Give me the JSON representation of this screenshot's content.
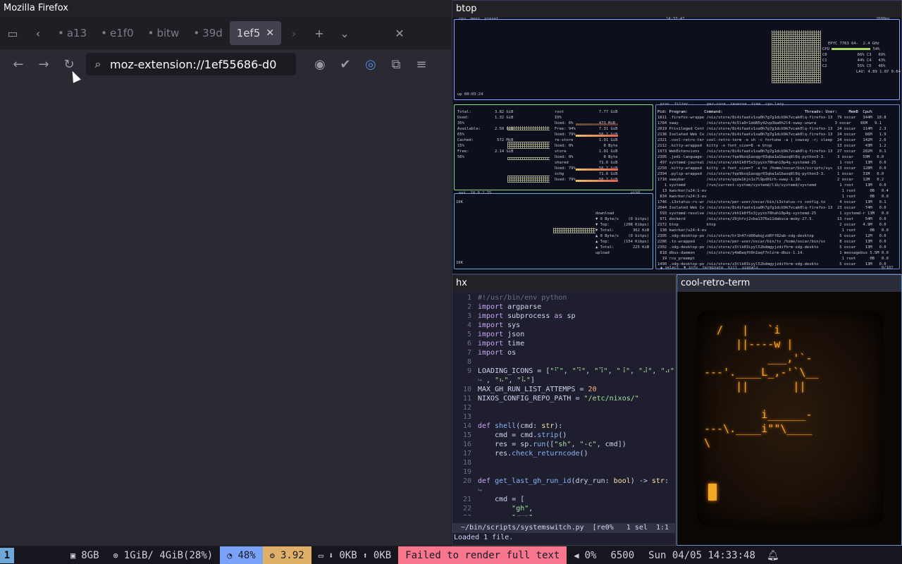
{
  "firefox": {
    "window_title": "Mozilla Firefox",
    "tabs": [
      {
        "label": "a13",
        "active": false
      },
      {
        "label": "e1f0",
        "active": false
      },
      {
        "label": "bitw",
        "active": false
      },
      {
        "label": "39d",
        "active": false
      },
      {
        "label": "1ef5",
        "active": true
      }
    ],
    "url": "moz-extension://1ef55686-d0"
  },
  "btop": {
    "window_title": "btop",
    "cpu": {
      "header": "cpu  menu  preset",
      "clock": "14:33:47",
      "interval": "2000ms",
      "model": "EPYC 7763 64-",
      "freq": "2.4 GHz",
      "rows": [
        {
          "label": "CPU",
          "value": "54%"
        },
        {
          "label": "C0",
          "value": "66% C3   69%"
        },
        {
          "label": "C1",
          "value": "44% C4   43%"
        },
        {
          "label": "C2",
          "value": "55% C5   46%"
        }
      ],
      "lav": "LAV: 4.89 1.07 0.64",
      "uptime": "up 00:03:24"
    },
    "mem": {
      "lines": [
        "Total:          3.82 GiB",
        "Used:           1.32 GiB",
        "35%",
        "Available:      2.50 GiB",
        "65%",
        "Cached:          572 MiB",
        "15%",
        "Free:           2.14 GiB",
        "56%"
      ],
      "disks": [
        "root               7.77 GiB",
        "IO%",
        "Used: 6%           473 MiB",
        "Free: 94%          7.31 GiB",
        "Used: 79%          56.2 GiB",
        "re-store           1.91 GiB",
        "Used: 0%             0 Byte",
        "store              1.91 GiB",
        "Used: 0%             0 Byte",
        "shared             71.6 GiB",
        "Used: 79%          56.2 GiB",
        "xchg               71.6 GiB",
        "Used: 79%          56.2 GiB"
      ]
    },
    "net": {
      "header": "net  10.0.2.15",
      "iface": "eth0",
      "scale_top": "10K",
      "scale_bottom": "10K",
      "lines": [
        "download",
        "▼ 0 Byte/s    (0 bitps)",
        "▼ Top:      (208 Kibps)",
        "▼ Total:        362 KiB",
        "",
        "▲ 0 Byte/s    (0 bitps)",
        "▲ Top:      (154 Kibps)",
        "▲ Total:        225 KiB",
        "upload"
      ]
    },
    "proc": {
      "header": "proc  filter        per-core  reverse  tree  cpu lazy",
      "columns": "Pid: Program:       Command:                                   Threads: User:     MemB  Cpu%",
      "rows": [
        "1811 .firefox-wrappe /nix/store/8i4ifaatv1xa0h7g7g1dcb9k7vcak0lq-firefox-13  79 oscar   344M  10.8",
        "1784 sway            /nix/store/4c5la0r1dd85y42vp3ba0h2l4-sway-unwra        3 oscar    66M   9.1",
        "2019 Privileged Cont /nix/store/8i4ifaatv1xa0h7g7g1dcb9k7vcak0lq-firefox-13  24 oscar   114M   2.3",
        "2136 Isolated Web Co /nix/store/8i4ifaatv1xa0h7g7g1dcb9k7vcak0lq-firefox-13  24 oscar    66M   1.9",
        "2321 .cool-retro-ter cool-retro-term -e sh -c fortune -a | cowsay -r; sleep  24 oscar   142M   2.6",
        "2112 .kitty-wrapped  kitty -o font_size=8 -e btop                            13 oscar    43M   1.2",
        "1973 WebExtensions   /nix/store/8i4ifaatv1xa0h7g7g1dcb9k7vcak0lq-firefox-13  27 oscar   202M   0.1",
        "2305 .jedi-language- /nix/store/fqe9bxq1axqgr03qba1a1baxq8l0q-python3-3.     3 oscar    50M   0.0",
        " 497 systemd-journal /nix/store/zkh1k0f5x3jyyxn78hah10p4q-systemd-25          1 root     13M   0.0",
        "2250 .kitty-wrapped  kitty -o font_size=7 -e hx /home/oscar/bin/scripts/sys  13 oscar   128M   0.0",
        "2394 .pylsp-wrapped  /nix/store/fqe9bxq1axqgr03qba1a1baxq8l0q-python3-3.     1 oscar    31M   0.0",
        "1710 swaybar         /nix/store/qqda1kjn1x7l9pd01rh-sway-1.10.               2 oscar    12M   0.2",
        "   1 systemd         /run/current-system/systemd/lib/systemd/systemd          1 root     13M   0.0",
        "  13 kworker/u24:1-ev                                                          1 root      0B   0.4",
        " 834 kworker/u24:3-ev                                                          1 root      0B   0.0",
        "1746 .i3status-rs-wr /nix/store/per-user/oscar/bin/i3status-rs config.to      4 oscar    13M   0.1",
        "2044 Isolated Web Co /nix/store/8i4ifaatv1xa0h7g7g1dcb9k7vcak0lq-firefox-13  23 oscar    74M   0.0",
        " 593 systemd-resolve /nix/store/zkh1k0f5x3jyyxn78hah10p4q-systemd-25          1 systemd-r 13M   0.0",
        " 971 dockerd         /nix/store/29jhfvj2xba1376a11dabsca-moby-27.5.          13 root     54M   0.0",
        "2172 btop            btop                                                     2 oscar   4.9M   0.0",
        " 130 kworker/u24:4-ev                                                          1 root      0B   0.0",
        "2305 .xdg-desktop-po /nix/store/hr1h47rd00abqjzd0ff82ab-xdg-desktop           5 oscar    12M   0.0",
        "2286 .tx-wrapped     /nix/store/per-user/oscar/bin/tx /home/oscar/bin/sc      8 oscar    13M   0.0",
        "2302 .xdg-desktop-po /nix/store/z3tlk03iyyl52bdmgyjzdifhrm-xdg-deskto         5 oscar    13M   0.0",
        " 818 dbus-daemon     /nix/store/y4m8aqfh0n1aqf7nlzrm-dbus-1.14.               1 messagebus 5.5M 0.0",
        "  19 rcu_preempt                                                               1 root      0B   0.0",
        "1490 .xdg-desktop-po /nix/store/z3tlk03iyyl52bdmgyjzdifhrm-xdg-deskto         5 oscar    13M   0.0"
      ],
      "footer": "▲ select  ▼ info  terminate  kill  signals",
      "count": "0/107"
    }
  },
  "hx": {
    "window_title": "hx",
    "lines": [
      {
        "n": "1",
        "html": "<span class=\"cm\">#!/usr/bin/env python</span>"
      },
      {
        "n": "2",
        "html": "<span class=\"kw\">import</span> argparse"
      },
      {
        "n": "3",
        "html": "<span class=\"kw\">import</span> subprocess <span class=\"kw\">as</span> sp"
      },
      {
        "n": "4",
        "html": "<span class=\"kw\">import</span> sys"
      },
      {
        "n": "5",
        "html": "<span class=\"kw\">import</span> json"
      },
      {
        "n": "6",
        "html": "<span class=\"kw\">import</span> time"
      },
      {
        "n": "7",
        "html": "<span class=\"kw\">import</span> os"
      },
      {
        "n": "8",
        "html": ""
      },
      {
        "n": "9",
        "html": "LOADING_ICONS = [<span class=\"str\">\"⠋\"</span>, <span class=\"str\">\"⠙\"</span>, <span class=\"str\">\"⠹\"</span>, <span class=\"str\">\"⠸\"</span>, <span class=\"str\">\"⠼\"</span>, <span class=\"str\">\"⠴\"</span>"
      },
      {
        "n": "",
        "html": "<span class=\"cm\">↪</span> , <span class=\"str\">\"⠦\"</span>, <span class=\"str\">\"⠧\"</span>]"
      },
      {
        "n": "10",
        "html": "MAX_GH_RUN_LIST_ATTEMPS = <span class=\"num\">20</span>"
      },
      {
        "n": "11",
        "html": "NIXOS_CONFIG_REPO_PATH = <span class=\"str\">\"/etc/nixos/\"</span>"
      },
      {
        "n": "12",
        "html": ""
      },
      {
        "n": "13",
        "html": ""
      },
      {
        "n": "14",
        "html": "<span class=\"kw\">def</span> <span class=\"fn\">shell</span>(cmd: <span class=\"ty\">str</span>):"
      },
      {
        "n": "15",
        "html": "    cmd = cmd.<span class=\"fn\">strip</span>()"
      },
      {
        "n": "16",
        "html": "    res = sp.<span class=\"fn\">run</span>([<span class=\"str\">\"sh\"</span>, <span class=\"str\">\"-c\"</span>, cmd])"
      },
      {
        "n": "17",
        "html": "    res.<span class=\"fn\">check_returncode</span>()"
      },
      {
        "n": "18",
        "html": ""
      },
      {
        "n": "19",
        "html": ""
      },
      {
        "n": "20",
        "html": "<span class=\"kw\">def</span> <span class=\"fn\">get_last_gh_run_id</span>(dry_run: <span class=\"ty\">bool</span>) -&gt; <span class=\"ty\">str</span>:"
      },
      {
        "n": "",
        "html": "<span class=\"cm\">↪</span>"
      },
      {
        "n": "21",
        "html": "    cmd = ["
      },
      {
        "n": "22",
        "html": "        <span class=\"str\">\"gh\"</span>,"
      },
      {
        "n": "23",
        "html": "        <span class=\"str\">\"run\"</span>,"
      }
    ],
    "status": "  ~/bin/scripts/systemswitch.py  [re0%   1 sel  1:1",
    "message": "Loaded 1 file."
  },
  "crt": {
    "window_title": "cool-retro-term",
    "art": "  /   |   `i\n     ||----w |\n          ___,'`-\n---'.____L_,-'`\\__\n     ||       ||\n\n         i______-\n---\\.____i\"\"\\____\n\\"
  },
  "bar": {
    "workspace": "1",
    "disk": "8GB",
    "mem": "1GiB/ 4GiB(28%)",
    "cpu": "48%",
    "load": "3.92",
    "net_down": "0KB",
    "net_up": "0KB",
    "error": "Failed to render full text",
    "volume": "0%",
    "temp": "6500",
    "datetime": "Sun 04/05 14:33:48",
    "colors": {
      "cpu": "#7aa2f7",
      "load": "#e0af68",
      "error": "#f7768e"
    }
  }
}
